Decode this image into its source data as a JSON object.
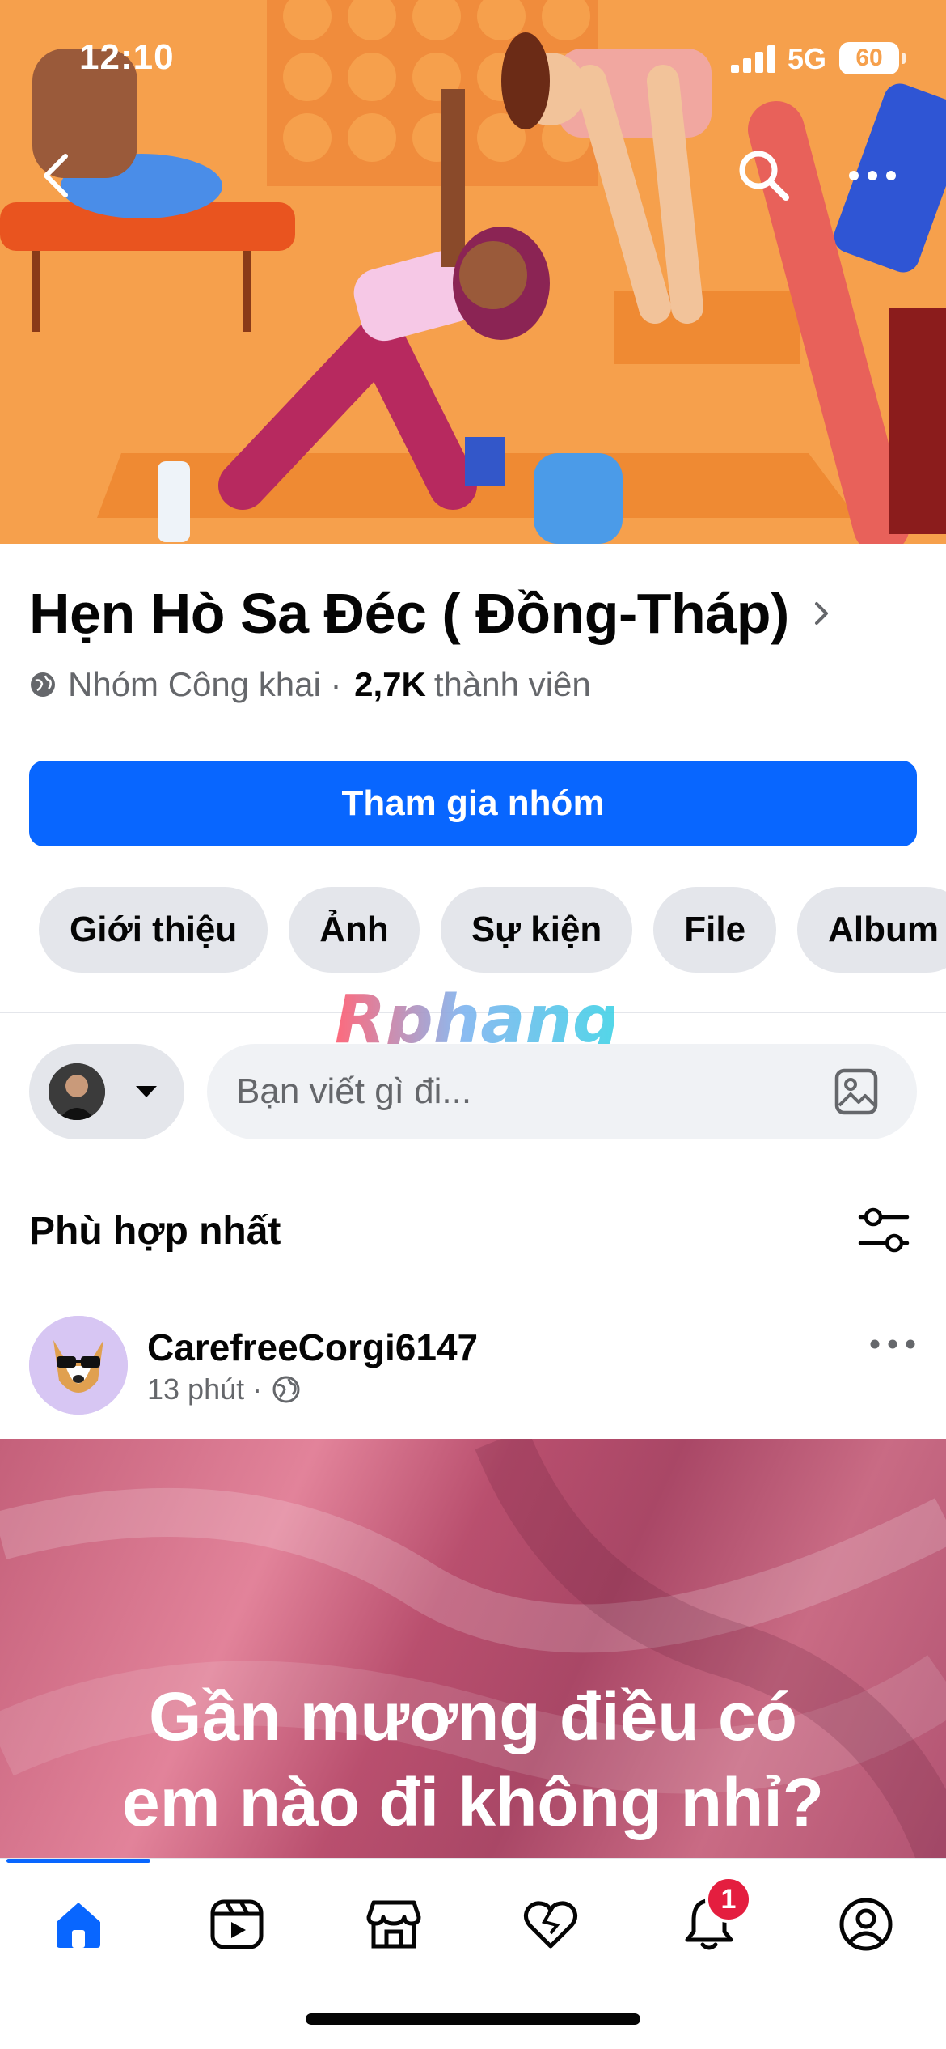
{
  "status_bar": {
    "time": "12:10",
    "network": "5G",
    "battery": "60"
  },
  "group": {
    "name": "Hẹn Hò Sa Đéc ( Đồng-Tháp)",
    "privacy": "Nhóm Công khai",
    "member_count": "2,7K",
    "member_label": "thành viên",
    "join_label": "Tham gia nhóm"
  },
  "chips": [
    "Giới thiệu",
    "Ảnh",
    "Sự kiện",
    "File",
    "Album"
  ],
  "watermark": "Rphang",
  "composer": {
    "placeholder": "Bạn viết gì đi..."
  },
  "feed": {
    "sort_label": "Phù hợp nhất"
  },
  "post": {
    "author": "CarefreeCorgi6147",
    "time": "13 phút",
    "text_line1": "Gần mương điều có",
    "text_line2": "em nào đi không nhỉ?"
  },
  "tabbar": {
    "items": [
      "home-icon",
      "video-icon",
      "marketplace-icon",
      "dating-icon",
      "notifications-icon",
      "profile-icon"
    ],
    "notifications_badge": "1"
  },
  "colors": {
    "accent": "#0866ff",
    "cover": "#f6a04c",
    "badge": "#e41e3f"
  }
}
